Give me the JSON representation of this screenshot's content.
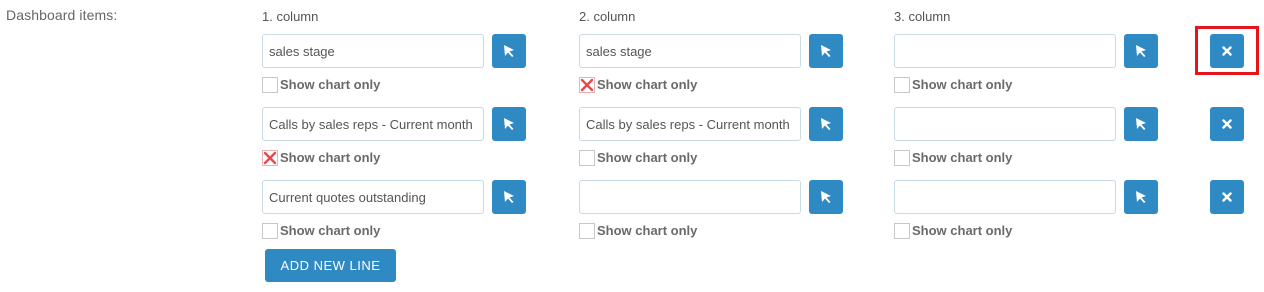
{
  "form": {
    "section_label": "Dashboard items:",
    "column_headers": [
      "1. column",
      "2. column",
      "3. column"
    ],
    "show_chart_label": "Show chart only",
    "add_line_label": "ADD NEW LINE",
    "rows": [
      {
        "cells": [
          {
            "value": "sales stage",
            "show_chart_only": false
          },
          {
            "value": "sales stage",
            "show_chart_only": true
          },
          {
            "value": "",
            "show_chart_only": false
          }
        ],
        "remove_highlighted": true
      },
      {
        "cells": [
          {
            "value": "Calls by sales reps - Current month",
            "show_chart_only": true
          },
          {
            "value": "Calls by sales reps - Current month",
            "show_chart_only": false
          },
          {
            "value": "",
            "show_chart_only": false
          }
        ],
        "remove_highlighted": false
      },
      {
        "cells": [
          {
            "value": "Current quotes outstanding",
            "show_chart_only": false
          },
          {
            "value": "",
            "show_chart_only": false
          },
          {
            "value": "",
            "show_chart_only": false
          }
        ],
        "remove_highlighted": false
      }
    ]
  },
  "icons": {
    "select": "cursor-arrow-icon",
    "remove": "close-icon",
    "checked_mark": "red-x-mark"
  },
  "colors": {
    "accent": "#2f8ac4",
    "highlight": "#e3151a",
    "check_mark": "#e8494e"
  }
}
